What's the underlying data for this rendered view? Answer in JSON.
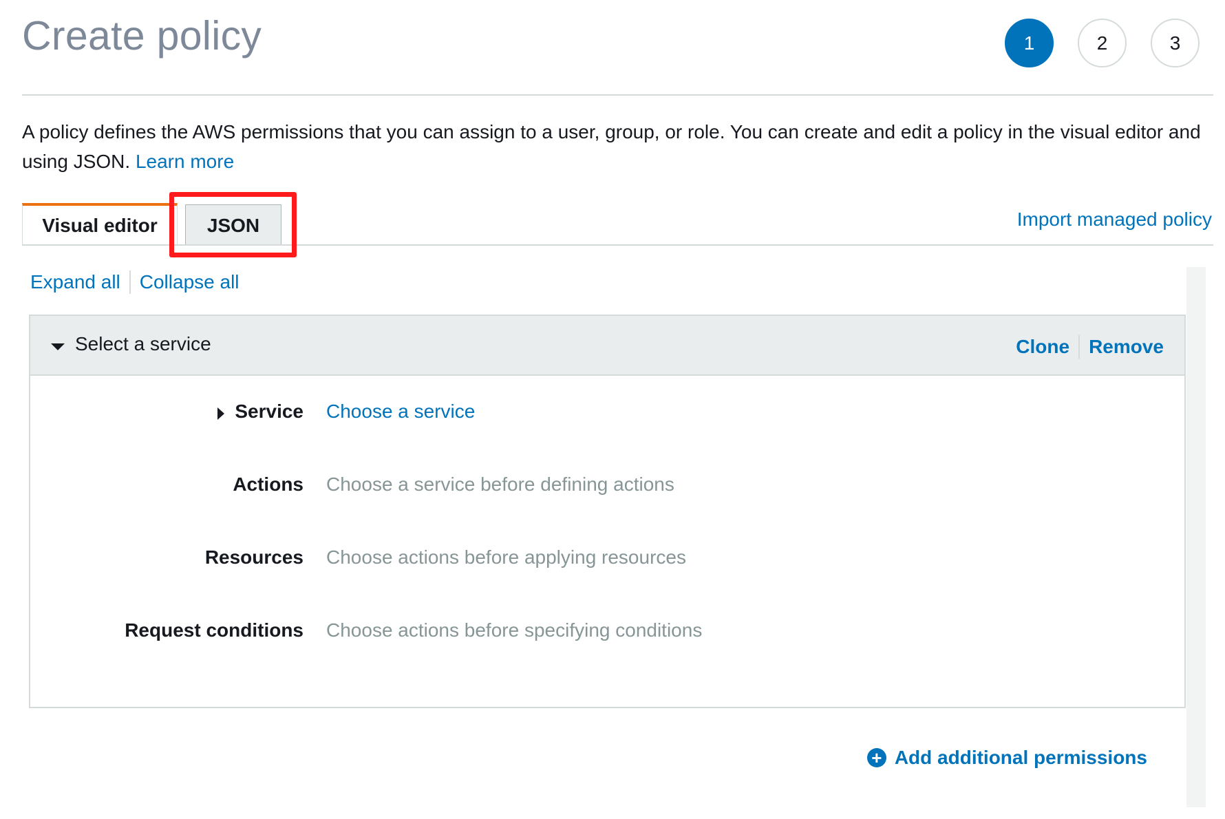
{
  "page": {
    "title": "Create policy",
    "steps": [
      "1",
      "2",
      "3"
    ],
    "active_step": "1"
  },
  "intro": {
    "text": "A policy defines the AWS permissions that you can assign to a user, group, or role. You can create and edit a policy in the visual editor and using JSON.",
    "learn_more": "Learn more"
  },
  "tabs": {
    "visual_editor": "Visual editor",
    "json": "JSON",
    "active": "Visual editor",
    "highlighted": "JSON"
  },
  "import_link": "Import managed policy",
  "toolbar": {
    "expand_all": "Expand all",
    "collapse_all": "Collapse all"
  },
  "panel": {
    "title": "Select a service",
    "clone": "Clone",
    "remove": "Remove",
    "rows": [
      {
        "label": "Service",
        "value": "Choose a service"
      },
      {
        "label": "Actions",
        "value": "Choose a service before defining actions"
      },
      {
        "label": "Resources",
        "value": "Choose actions before applying resources"
      },
      {
        "label": "Request conditions",
        "value": "Choose actions before specifying conditions"
      }
    ]
  },
  "add_permissions": "Add additional permissions",
  "colors": {
    "link": "#0073bb",
    "active_step": "#0073bb",
    "active_tab_accent": "#ec7211",
    "highlight_box": "#ff1b1b",
    "muted_text": "#879596"
  },
  "icons": [
    "caret-down-icon",
    "caret-right-icon",
    "plus-circle-icon"
  ]
}
